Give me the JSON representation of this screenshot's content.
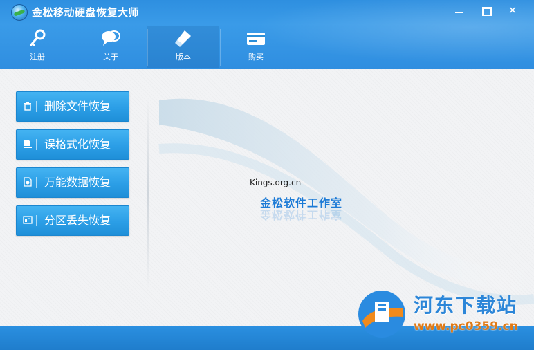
{
  "window": {
    "title": "金松移动硬盘恢复大师",
    "controls": {
      "minimize": "—",
      "close": "✕"
    }
  },
  "toolbar": [
    {
      "label": "注册",
      "icon": "key-icon"
    },
    {
      "label": "关于",
      "icon": "speech-bubbles-icon"
    },
    {
      "label": "版本",
      "icon": "eraser-icon"
    },
    {
      "label": "购买",
      "icon": "credit-card-icon"
    }
  ],
  "actions": [
    {
      "label": "删除文件恢复",
      "icon": "trash-icon"
    },
    {
      "label": "误格式化恢复",
      "icon": "format-icon"
    },
    {
      "label": "万能数据恢复",
      "icon": "document-gear-icon"
    },
    {
      "label": "分区丢失恢复",
      "icon": "partition-icon"
    }
  ],
  "brand": {
    "site": "Kings.org.cn",
    "studio": "金松软件工作室"
  },
  "watermark": {
    "name": "河东下载站",
    "url": "www.pc0359.cn"
  },
  "colors": {
    "accent": "#2b9ee6",
    "title_bar": "#2e8fe0",
    "watermark_blue": "#2c86d8",
    "watermark_orange": "#e07a16"
  }
}
